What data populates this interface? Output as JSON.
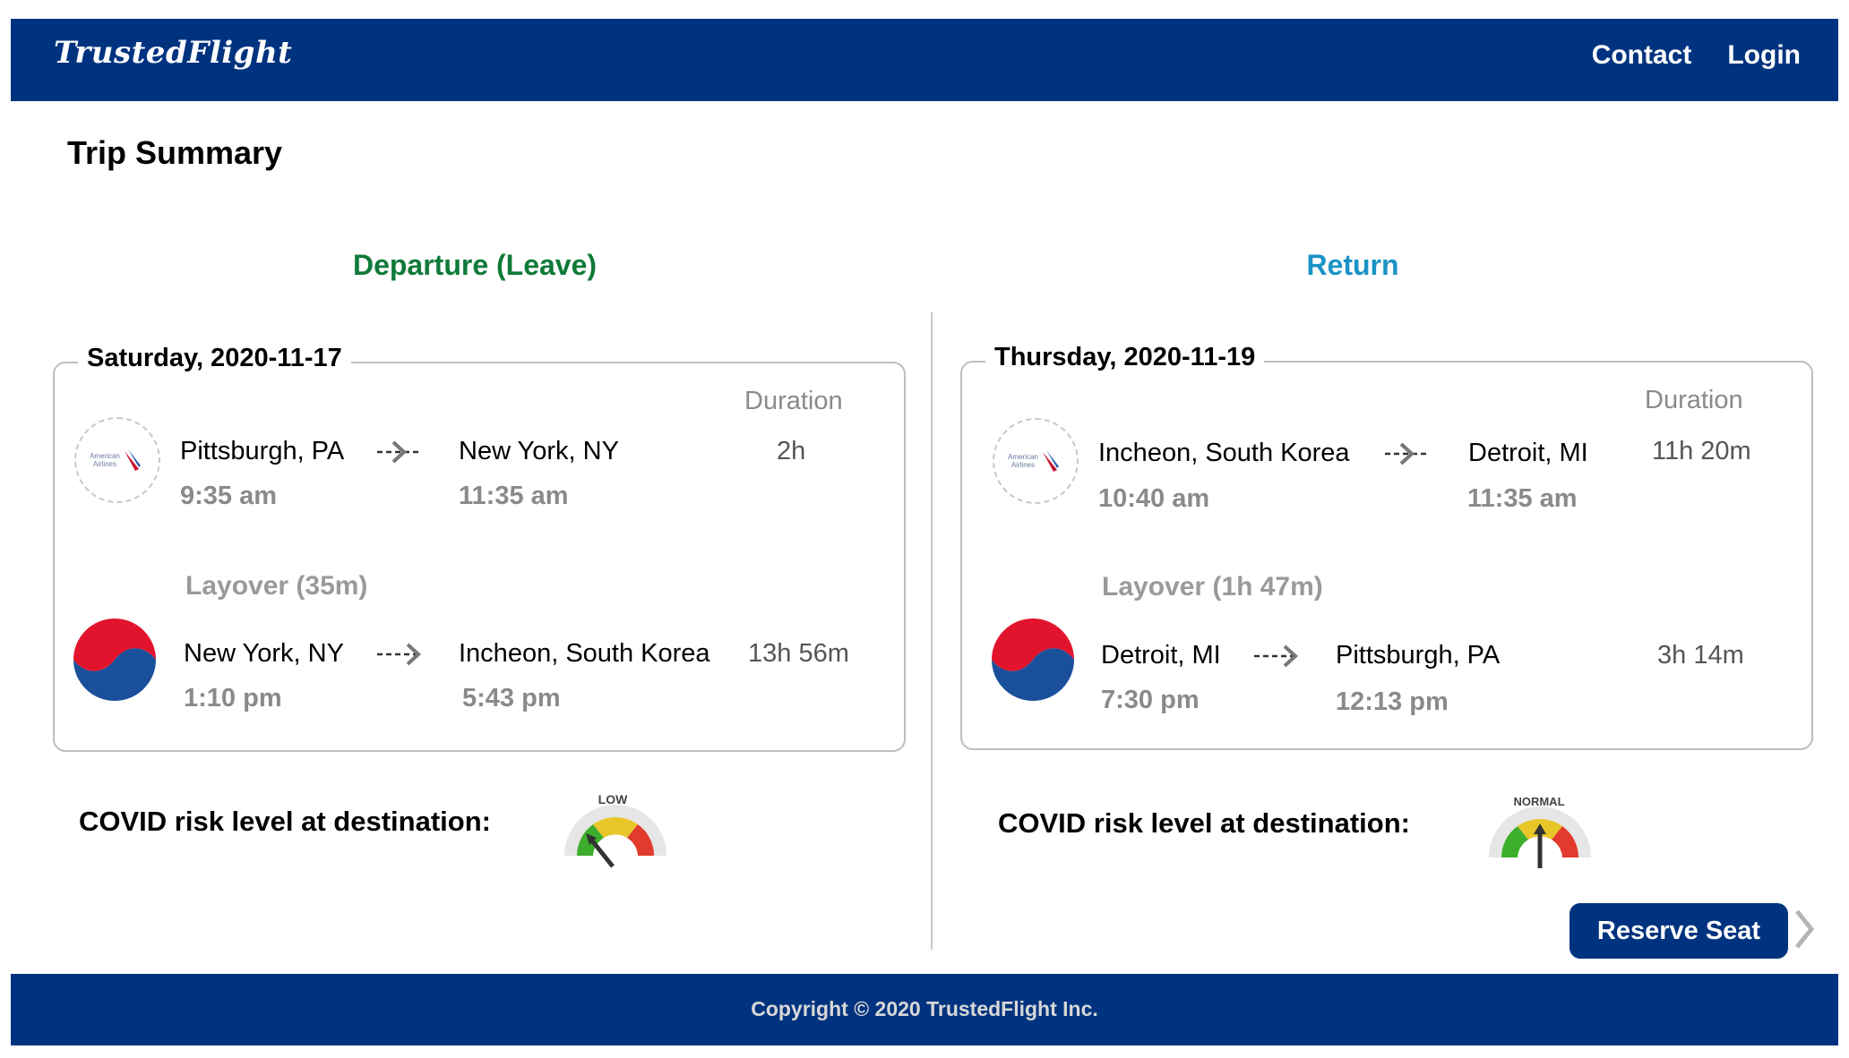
{
  "header": {
    "logo": "TrustedFlight",
    "nav": {
      "contact": "Contact",
      "login": "Login"
    }
  },
  "page_title": "Trip Summary",
  "departure": {
    "heading": "Departure (Leave)",
    "date": "Saturday, 2020-11-17",
    "duration_label": "Duration",
    "layover": "Layover (35m)",
    "legs": [
      {
        "airline_icon": "american-airlines-logo",
        "from": "Pittsburgh, PA",
        "to": "New York, NY",
        "depart_time": "9:35 am",
        "arrive_time": "11:35 am",
        "duration": "2h"
      },
      {
        "airline_icon": "korean-air-logo",
        "from": "New York, NY",
        "to": "Incheon, South Korea",
        "depart_time": "1:10 pm",
        "arrive_time": "5:43 pm",
        "duration": "13h 56m"
      }
    ],
    "covid_label": "COVID risk level at destination:",
    "covid_level": "LOW"
  },
  "return": {
    "heading": "Return",
    "date": "Thursday, 2020-11-19",
    "duration_label": "Duration",
    "layover": "Layover (1h 47m)",
    "legs": [
      {
        "airline_icon": "american-airlines-logo",
        "from": "Incheon, South Korea",
        "to": "Detroit, MI",
        "depart_time": "10:40 am",
        "arrive_time": "11:35 am",
        "duration": "11h 20m"
      },
      {
        "airline_icon": "korean-air-logo",
        "from": "Detroit, MI",
        "to": "Pittsburgh, PA",
        "depart_time": "7:30 pm",
        "arrive_time": "12:13 pm",
        "duration": "3h 14m"
      }
    ],
    "covid_label": "COVID risk level at destination:",
    "covid_level": "NORMAL"
  },
  "actions": {
    "reserve_label": "Reserve Seat"
  },
  "footer": {
    "copyright": "Copyright © 2020 TrustedFlight Inc."
  },
  "colors": {
    "brand_navy": "#00337f",
    "departure_green": "#0f7a39",
    "return_blue": "#1b93c4"
  }
}
